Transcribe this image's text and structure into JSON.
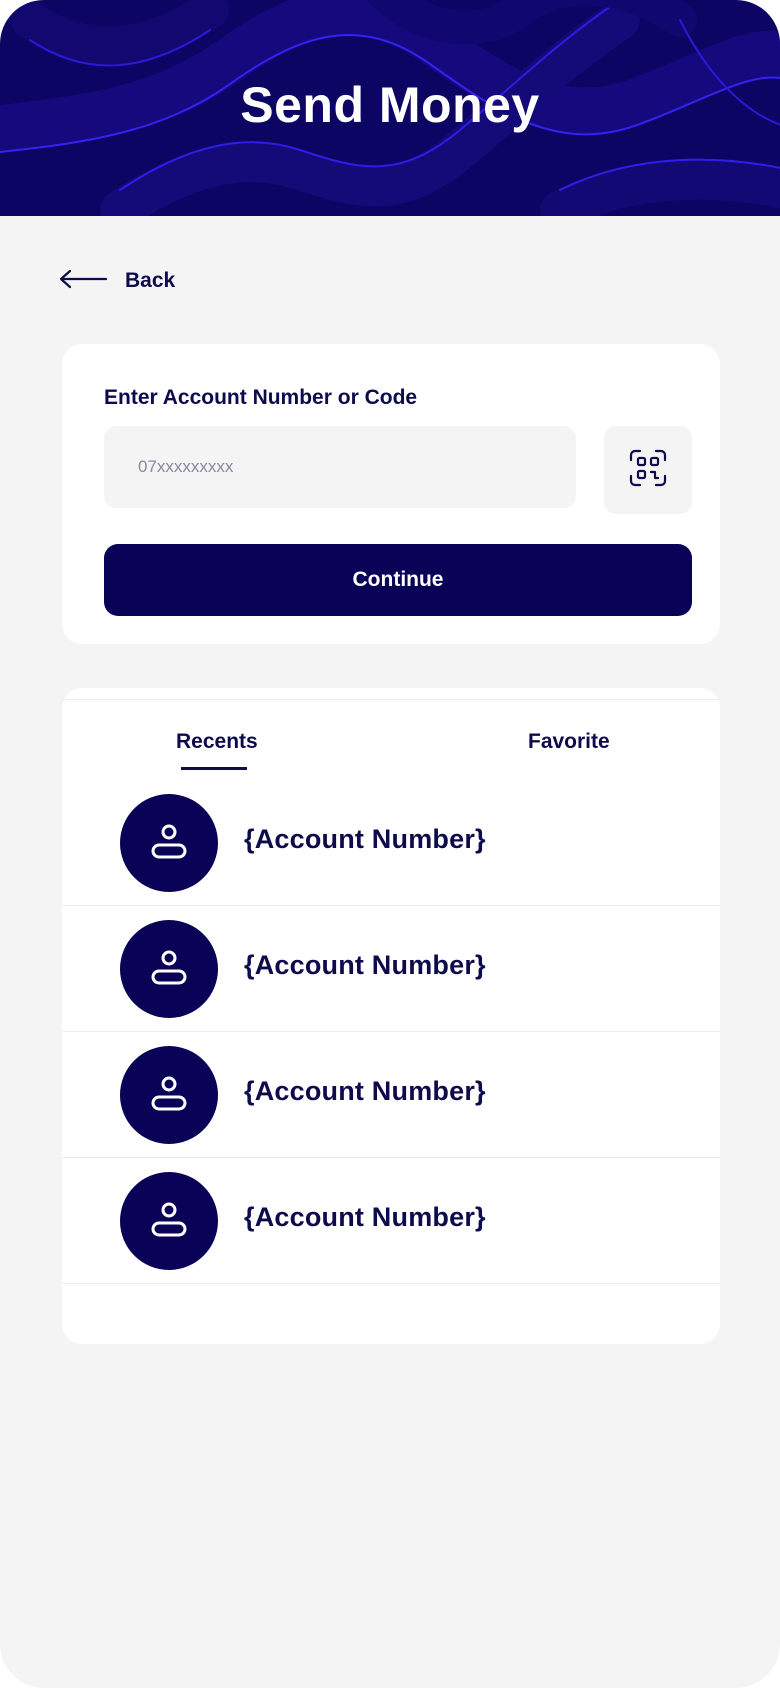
{
  "header": {
    "title": "Send Money"
  },
  "nav": {
    "back_label": "Back",
    "back_icon": "arrow-left-icon"
  },
  "account_form": {
    "label": "Enter Account Number or Code",
    "placeholder": "07xxxxxxxxx",
    "value": "",
    "scan_icon": "scan-qr-icon",
    "continue_label": "Continue"
  },
  "tabs": [
    {
      "label": "Recents",
      "active": true
    },
    {
      "label": "Favorite",
      "active": false
    }
  ],
  "recents": [
    {
      "label": "{Account Number}",
      "icon": "user-icon"
    },
    {
      "label": "{Account Number}",
      "icon": "user-icon"
    },
    {
      "label": "{Account Number}",
      "icon": "user-icon"
    },
    {
      "label": "{Account Number}",
      "icon": "user-icon"
    }
  ],
  "colors": {
    "brand": "#0a0257",
    "header_bg": "#0c0563",
    "accent_stroke": "#2a1fe0",
    "text": "#0c0b4c",
    "background": "#f4f4f4"
  }
}
